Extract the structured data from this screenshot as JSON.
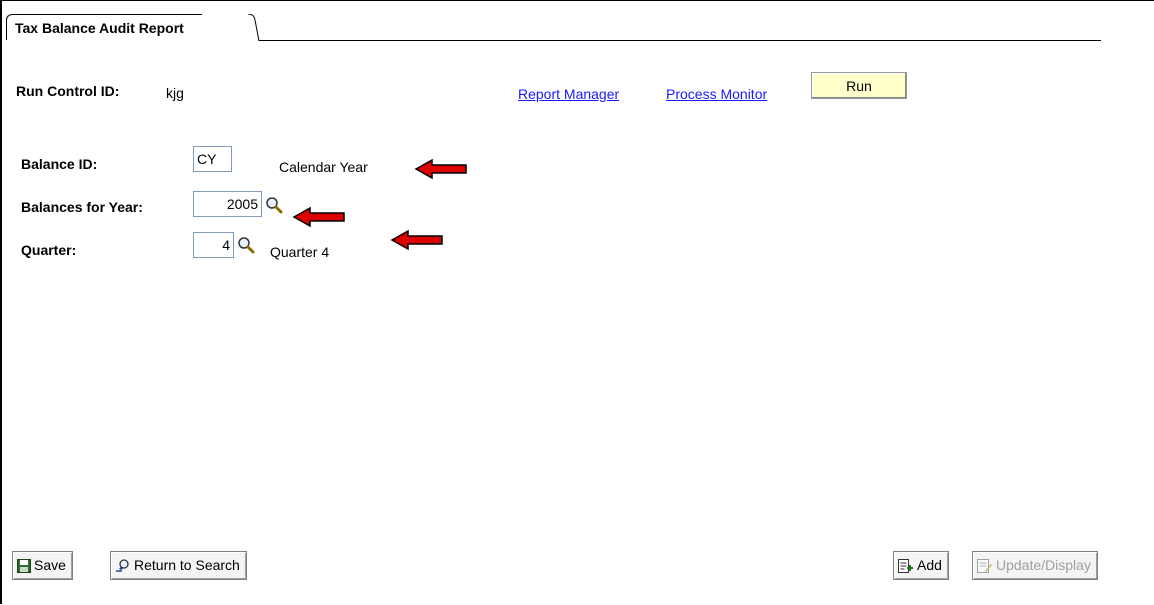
{
  "tab": {
    "label": "Tax Balance Audit Report"
  },
  "run_control": {
    "label": "Run Control ID:",
    "value": "kjg"
  },
  "links": {
    "report_manager": "Report Manager",
    "process_monitor": "Process Monitor"
  },
  "run_button": {
    "label": "Run"
  },
  "balance_id": {
    "label": "Balance ID:",
    "value": "CY",
    "description": "Calendar Year"
  },
  "balances_year": {
    "label": "Balances for Year:",
    "value": "2005"
  },
  "quarter": {
    "label": "Quarter:",
    "value": "4",
    "description": "Quarter 4"
  },
  "footer": {
    "save": "Save",
    "return_to_search": "Return to Search",
    "add": "Add",
    "update_display": "Update/Display"
  },
  "colors": {
    "link": "#1a1aff",
    "run_button_bg": "#ffffcc",
    "arrow": "#dd0000"
  }
}
